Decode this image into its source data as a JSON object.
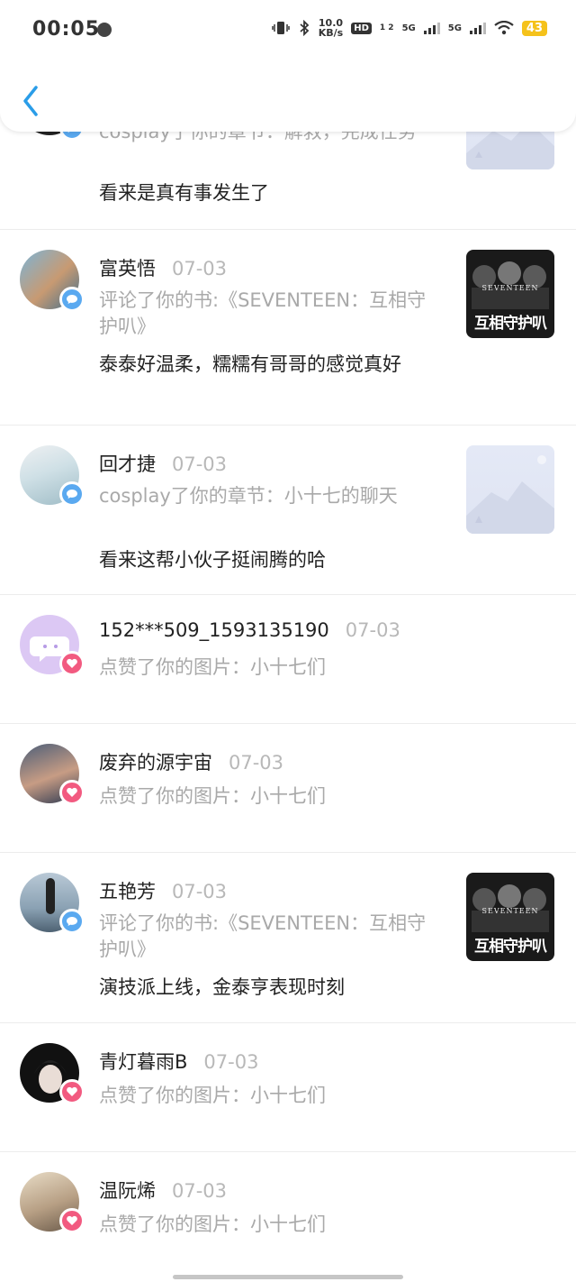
{
  "status_bar": {
    "time": "00:05",
    "net_speed_value": "10.0",
    "net_speed_unit": "KB/s",
    "hd": "HD",
    "hd_sims": "1 2",
    "sig1": "5G",
    "sig2": "5G",
    "battery": "43"
  },
  "colors": {
    "comment_badge": "#5aa9f0",
    "like_badge": "#f25a80",
    "date": "#b8b8b8",
    "action_text": "#a9a9a9"
  },
  "notifications": [
    {
      "name": "",
      "date": "",
      "action": "cosplay了你的章节：解救，完成任务",
      "content": "看来是真有事发生了",
      "badge": "comment-icon",
      "thumb": "placeholder"
    },
    {
      "name": "富英悟",
      "date": "07-03",
      "action": "评论了你的书:《SEVENTEEN：互相守护叭》",
      "content": "泰泰好温柔，糯糯有哥哥的感觉真好",
      "badge": "comment-icon",
      "thumb": "cover"
    },
    {
      "name": "回才捷",
      "date": "07-03",
      "action": "cosplay了你的章节：小十七的聊天",
      "content": "看来这帮小伙子挺闹腾的哈",
      "badge": "comment-icon",
      "thumb": "placeholder"
    },
    {
      "name": "152***509_1593135190",
      "date": "07-03",
      "action": "点赞了你的图片：小十七们",
      "content": "",
      "badge": "heart-icon",
      "thumb": "none"
    },
    {
      "name": "废弃的源宇宙",
      "date": "07-03",
      "action": "点赞了你的图片：小十七们",
      "content": "",
      "badge": "heart-icon",
      "thumb": "none"
    },
    {
      "name": "五艳芳",
      "date": "07-03",
      "action": "评论了你的书:《SEVENTEEN：互相守护叭》",
      "content": "演技派上线，金泰亨表现时刻",
      "badge": "comment-icon",
      "thumb": "cover"
    },
    {
      "name": "青灯暮雨B",
      "date": "07-03",
      "action": "点赞了你的图片：小十七们",
      "content": "",
      "badge": "heart-icon",
      "thumb": "none"
    },
    {
      "name": "温阮烯",
      "date": "07-03",
      "action": "点赞了你的图片：小十七们",
      "content": "",
      "badge": "heart-icon",
      "thumb": "none"
    }
  ],
  "cover_text": {
    "title": "互相守护叭",
    "subtitle": "SEVENTEEN"
  }
}
